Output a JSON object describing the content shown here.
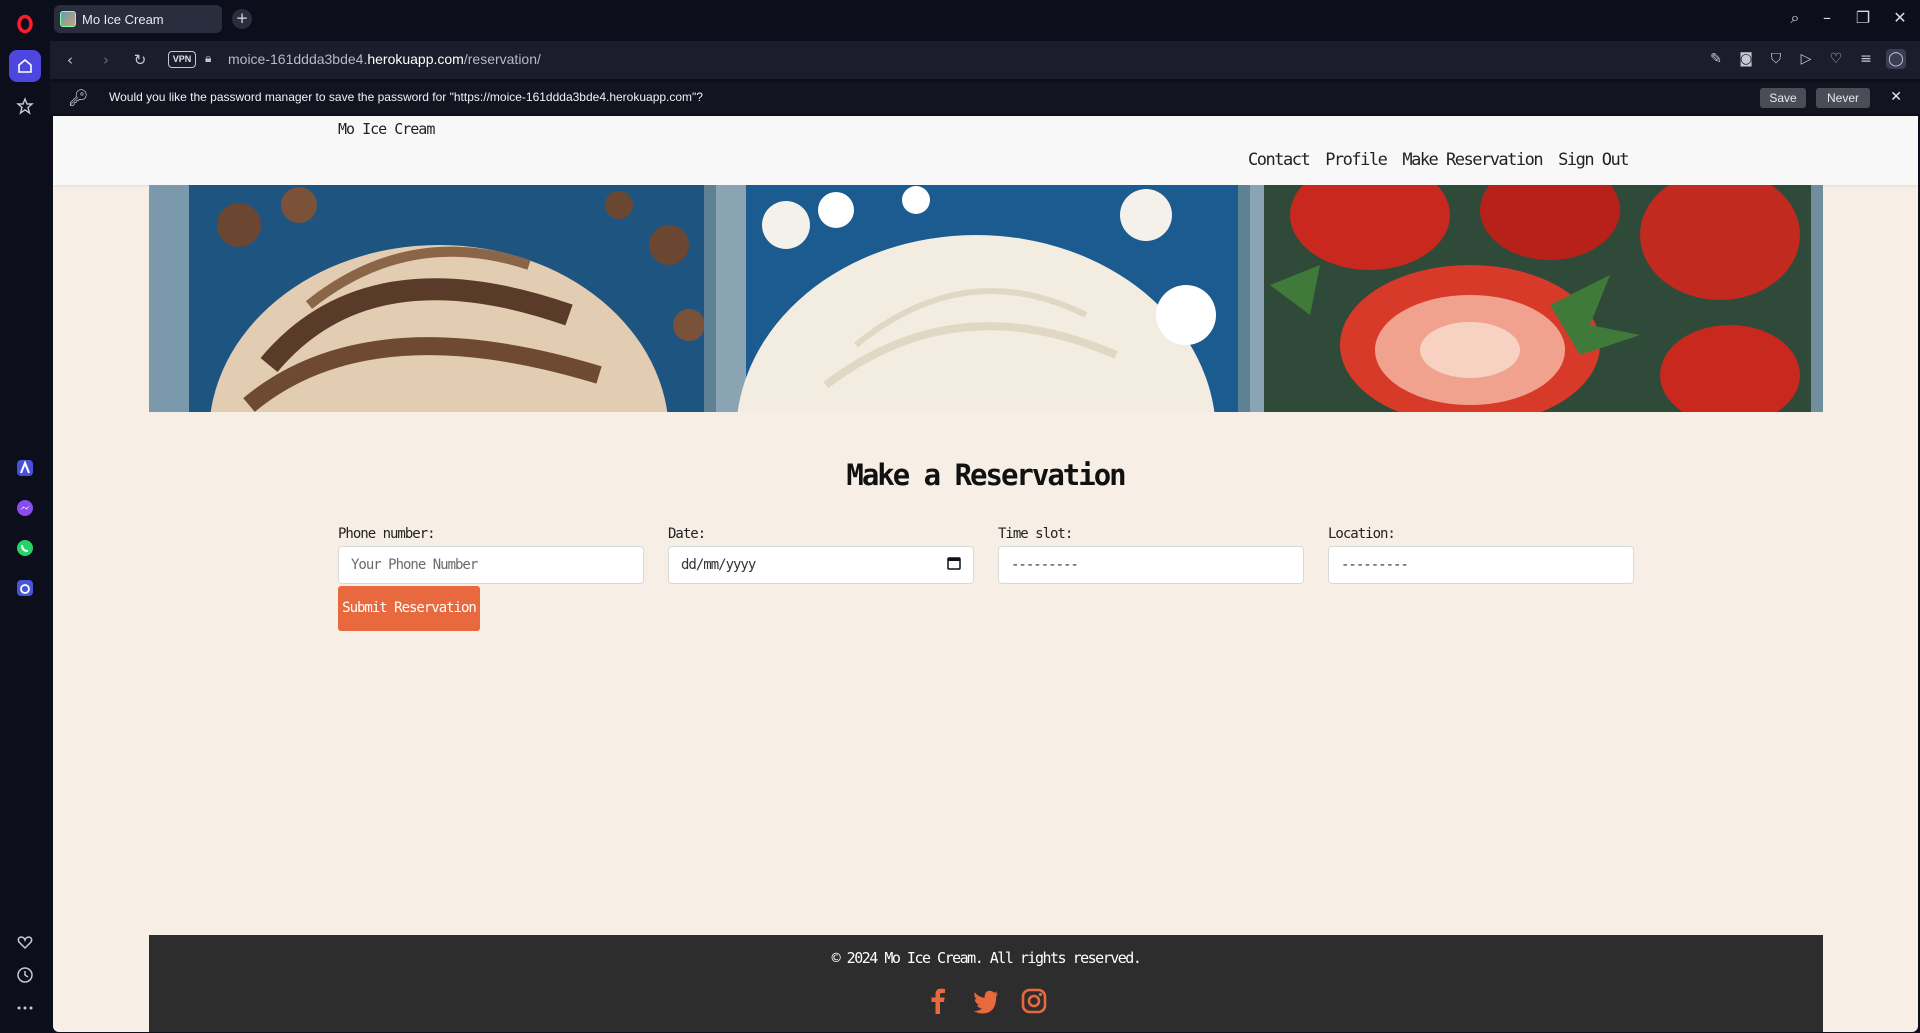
{
  "browser": {
    "tab_title": "Mo Ice Cream",
    "url_prefix": "moice-161ddda3bde4.",
    "url_domain": "herokuapp.com",
    "url_path": "/reservation/",
    "vpn_label": "VPN",
    "password_prompt": "Would you like the password manager to save the password for \"https://moice-161ddda3bde4.herokuapp.com\"?",
    "save_label": "Save",
    "never_label": "Never"
  },
  "site": {
    "brand": "Mo Ice Cream",
    "nav": [
      "Contact",
      "Profile",
      "Make Reservation",
      "Sign Out"
    ]
  },
  "form": {
    "heading": "Make a Reservation",
    "phone_label": "Phone number:",
    "phone_placeholder": "Your Phone Number",
    "date_label": "Date:",
    "date_value": "dd/mm/yyyy",
    "timeslot_label": "Time slot:",
    "timeslot_value": "---------",
    "location_label": "Location:",
    "location_value": "---------",
    "submit_label": "Submit Reservation"
  },
  "footer": {
    "copyright": "© 2024 Mo Ice Cream. All rights reserved.",
    "socials": [
      "facebook-icon",
      "twitter-icon",
      "instagram-icon"
    ]
  },
  "colors": {
    "accent": "#e8693d",
    "page_bg": "#f7efe6",
    "footer_bg": "#2d2d2d"
  }
}
